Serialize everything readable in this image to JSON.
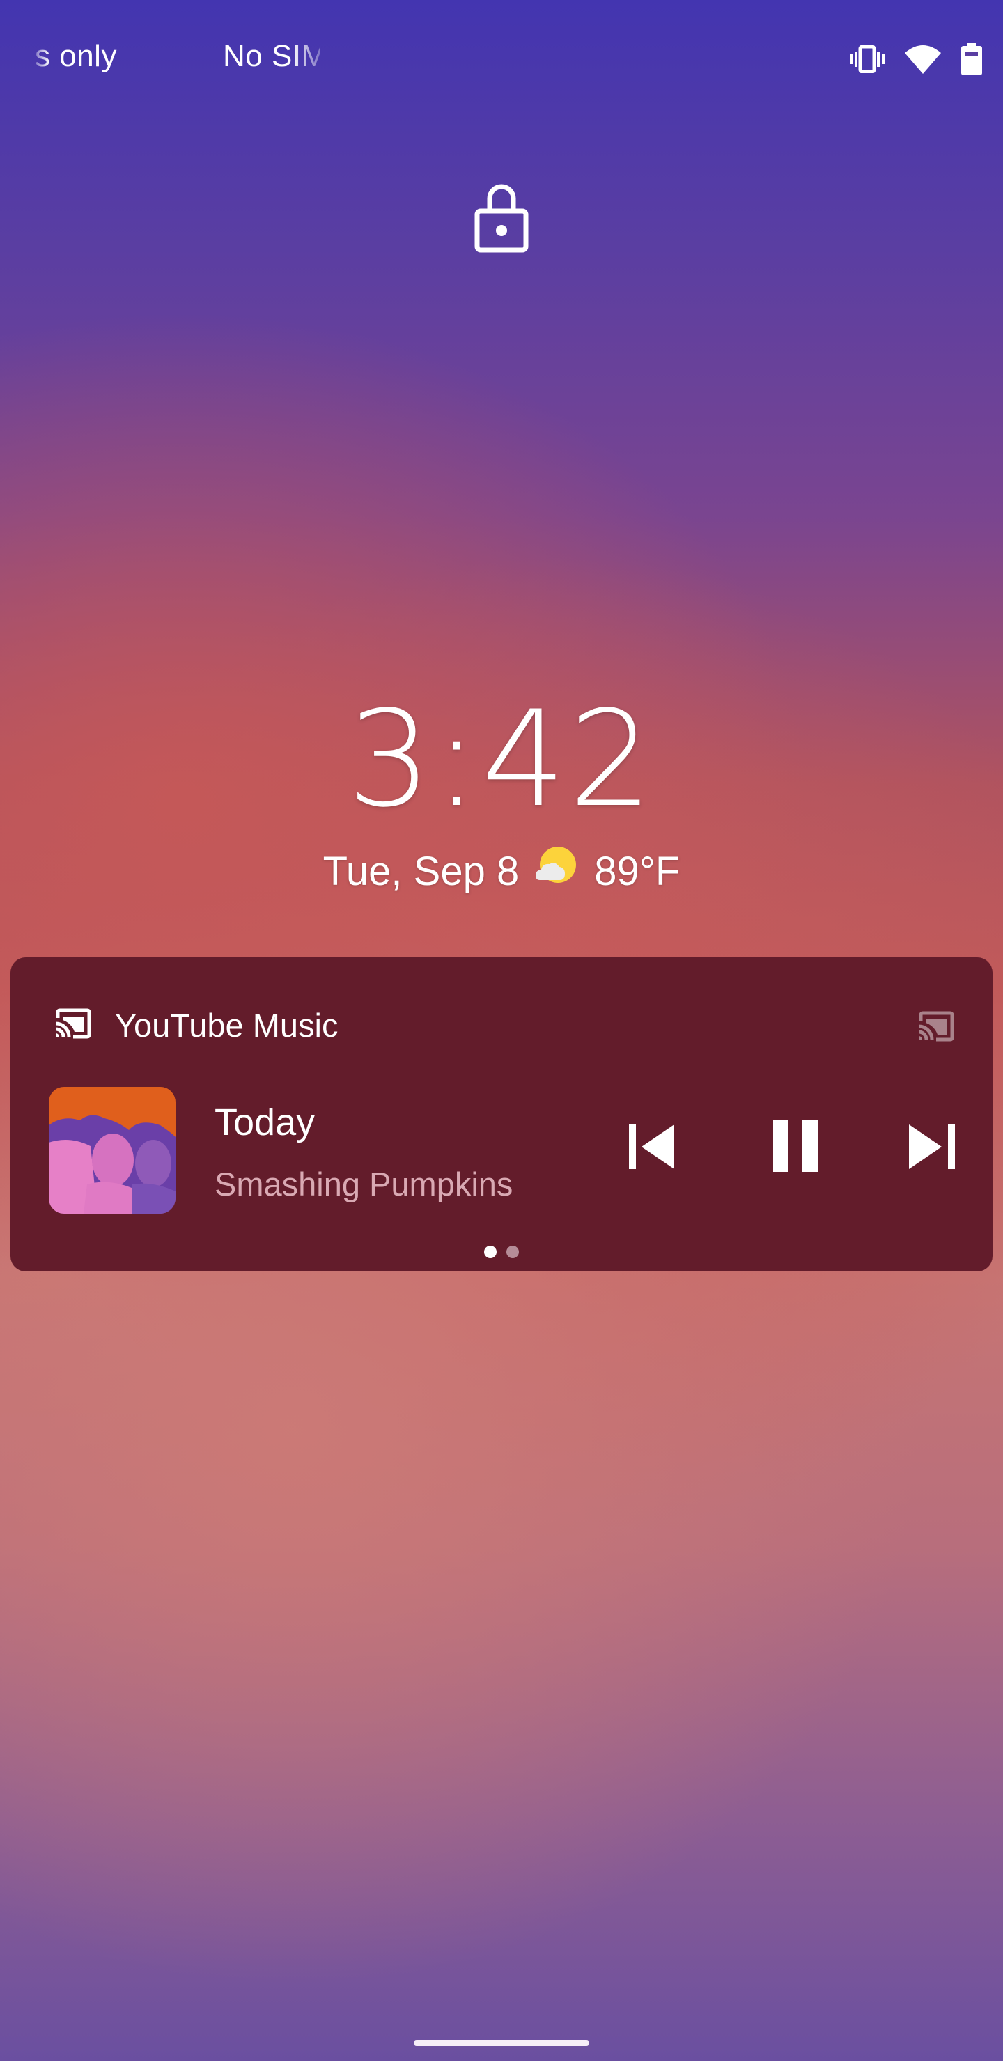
{
  "status_bar": {
    "carrier_1": "s only",
    "carrier_2": "No SIM",
    "icons": [
      "vibrate-icon",
      "wifi-icon",
      "battery-icon"
    ]
  },
  "lock_screen": {
    "lock_icon": "lock-icon",
    "clock": {
      "hours": "3",
      "separator": ":",
      "minutes": "42"
    },
    "date": "Tue, Sep 8",
    "weather": {
      "icon": "partly-cloudy-icon",
      "temperature": "89°F"
    }
  },
  "media_player": {
    "app_name": "YouTube Music",
    "app_icon": "cast-icon",
    "output_icon": "cast-icon",
    "song_title": "Today",
    "artist": "Smashing Pumpkins",
    "controls": [
      "previous",
      "pause",
      "next"
    ],
    "page_indicator": {
      "current": 1,
      "total": 2
    },
    "colors": {
      "card_bg": "#631c2b",
      "artist_text": "#d9a9b3"
    }
  },
  "nav": {
    "handle": "gesture-handle"
  }
}
